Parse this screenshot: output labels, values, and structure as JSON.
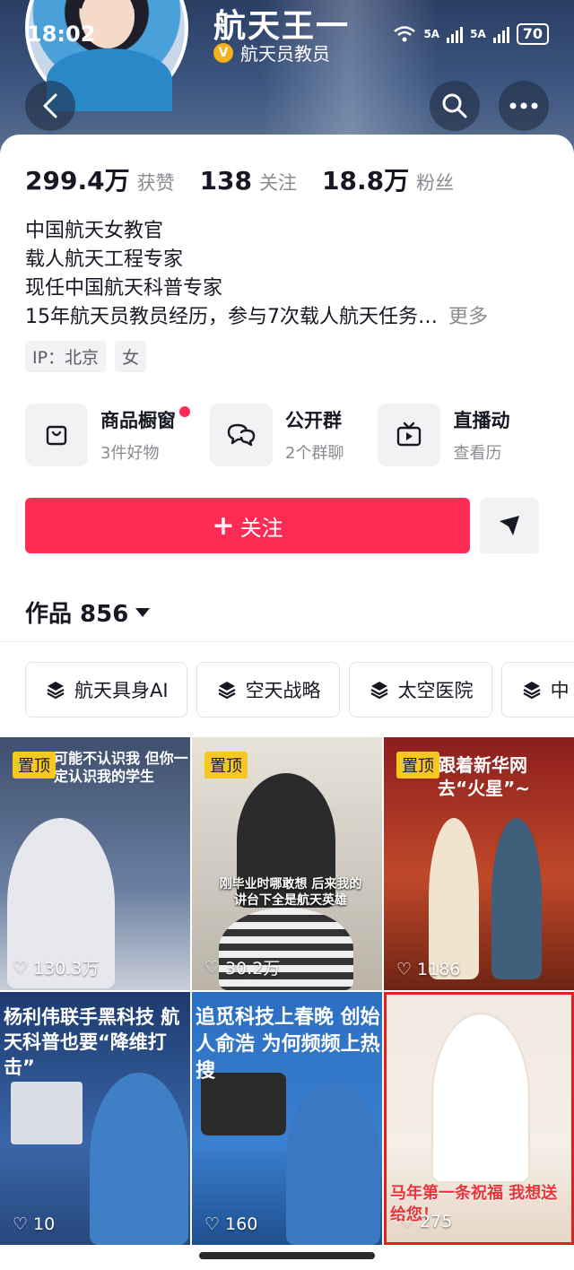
{
  "status_bar": {
    "time": "18:02",
    "network_1": "5A",
    "network_2": "5A",
    "battery": "70"
  },
  "profile": {
    "name": "航天王一",
    "verified_title": "航天员教员",
    "stats": [
      {
        "value": "299.4万",
        "label": "获赞"
      },
      {
        "value": "138",
        "label": "关注"
      },
      {
        "value": "18.8万",
        "label": "粉丝"
      }
    ],
    "bio_lines": [
      "中国航天女教官",
      "载人航天工程专家",
      "现任中国航天科普专家",
      "15年航天员教员经历，参与7次载人航天任务…"
    ],
    "bio_more": "更多",
    "tags": [
      "IP：北京",
      "女"
    ]
  },
  "features": [
    {
      "title": "商品橱窗",
      "subtitle": "3件好物",
      "icon": "shopping-bag-icon"
    },
    {
      "title": "公开群",
      "subtitle": "2个群聊",
      "icon": "chat-bubbles-icon"
    },
    {
      "title": "直播动",
      "subtitle": "查看历",
      "icon": "tv-icon"
    }
  ],
  "actions": {
    "follow_label": "关注",
    "follow_plus": "+",
    "accent": "#fe2c55"
  },
  "works": {
    "title": "作品 856"
  },
  "collections": [
    "航天具身AI",
    "空天战略",
    "太空医院",
    "中"
  ],
  "videos": [
    {
      "pinned": "置顶",
      "likes": "130.3万",
      "caption": "可能不认识我 但你一定认识我的学生"
    },
    {
      "pinned": "置顶",
      "likes": "30.2万",
      "caption": "刚毕业时哪敢想 后来我的讲台下全是航天英雄"
    },
    {
      "pinned": "置顶",
      "likes": "1186",
      "caption": "跟着新华网 去“火星”~"
    },
    {
      "pinned": "",
      "likes": "10",
      "caption": "杨利伟联手黑科技 航天科普也要“降维打击”"
    },
    {
      "pinned": "",
      "likes": "160",
      "caption": "追觅科技上春晚 创始人俞浩 为何频频上热搜"
    },
    {
      "pinned": "",
      "likes": "275",
      "caption": "马年第一条祝福 我想送给您！"
    }
  ]
}
